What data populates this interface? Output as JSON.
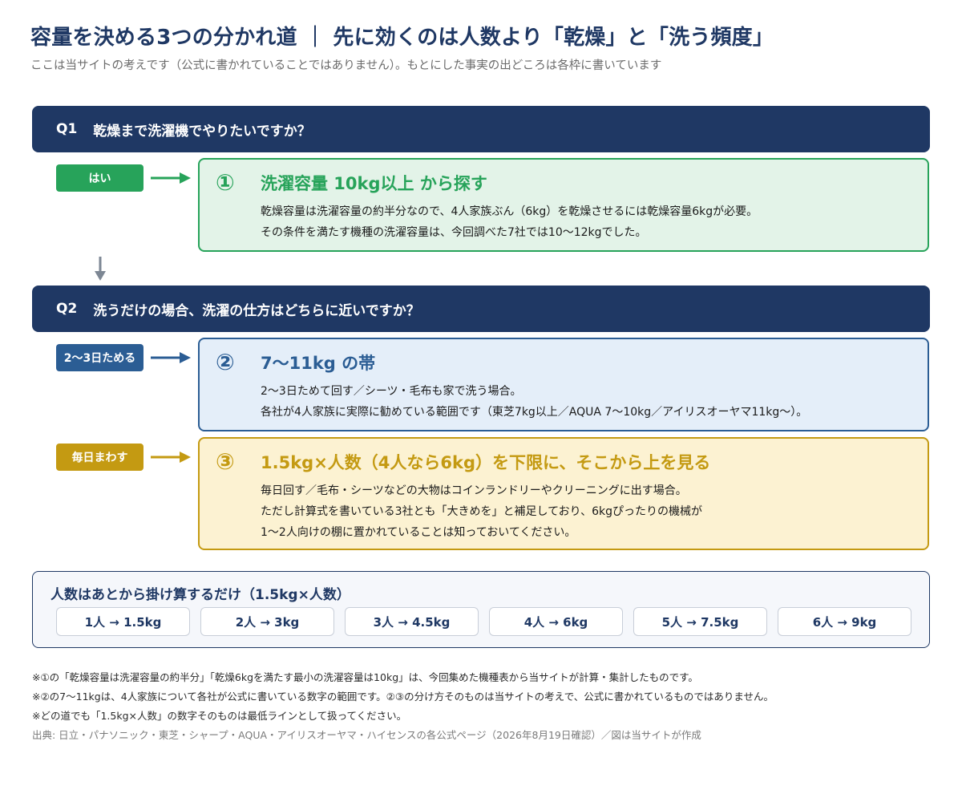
{
  "title": "容量を決める3つの分かれ道 ｜ 先に効くのは人数より「乾燥」と「洗う頻度」",
  "subtitle": "ここは当サイトの考えです（公式に書かれていることではありません）。もとにした事実の出どころは各枠に書いています",
  "colors": {
    "navy": "#1f3864",
    "green": "#27a35a",
    "green_bg": "#e3f3e8",
    "blue": "#2b5d94",
    "blue_bg": "#e4eef9",
    "gold": "#c49a12",
    "gold_bg": "#fcf2d2"
  },
  "q1": {
    "num": "Q1",
    "text": "乾燥まで洗濯機でやりたいですか？",
    "tag": "はい"
  },
  "card1": {
    "num": "①",
    "heading": "洗濯容量 10kg以上 から探す",
    "line1": "乾燥容量は洗濯容量の約半分なので、4人家族ぶん（6kg）を乾燥させるには乾燥容量6kgが必要。",
    "line2": "その条件を満たす機種の洗濯容量は、今回調べた7社では10〜12kgでした。"
  },
  "q2": {
    "num": "Q2",
    "text": "洗うだけの場合、洗濯の仕方はどちらに近いですか？",
    "tag_a": "2〜3日ためる",
    "tag_b": "毎日まわす"
  },
  "card2": {
    "num": "②",
    "heading": "7〜11kg の帯",
    "line1": "2〜3日ためて回す／シーツ・毛布も家で洗う場合。",
    "line2": "各社が4人家族に実際に勧めている範囲です（東芝7kg以上／AQUA 7〜10kg／アイリスオーヤマ11kg〜）。"
  },
  "card3": {
    "num": "③",
    "heading": "1.5kg×人数（4人なら6kg）を下限に、そこから上を見る",
    "line1": "毎日回す／毛布・シーツなどの大物はコインランドリーやクリーニングに出す場合。",
    "line2": "ただし計算式を書いている3社とも「大きめを」と補足しており、6kgぴったりの機械が",
    "line3": "1〜2人向けの棚に置かれていることは知っておいてください。"
  },
  "calc": {
    "heading": "人数はあとから掛け算するだけ（1.5kg×人数）",
    "items": [
      "1人 → 1.5kg",
      "2人 → 3kg",
      "3人 → 4.5kg",
      "4人 → 6kg",
      "5人 → 7.5kg",
      "6人 → 9kg"
    ]
  },
  "notes": [
    "※①の「乾燥容量は洗濯容量の約半分」「乾燥6kgを満たす最小の洗濯容量は10kg」は、今回集めた機種表から当サイトが計算・集計したものです。",
    "※②の7〜11kgは、4人家族について各社が公式に書いている数字の範囲です。②③の分け方そのものは当サイトの考えで、公式に書かれているものではありません。",
    "※どの道でも「1.5kg×人数」の数字そのものは最低ラインとして扱ってください。"
  ],
  "source": "出典: 日立・パナソニック・東芝・シャープ・AQUA・アイリスオーヤマ・ハイセンスの各公式ページ（2026年8月19日確認）／図は当サイトが作成"
}
